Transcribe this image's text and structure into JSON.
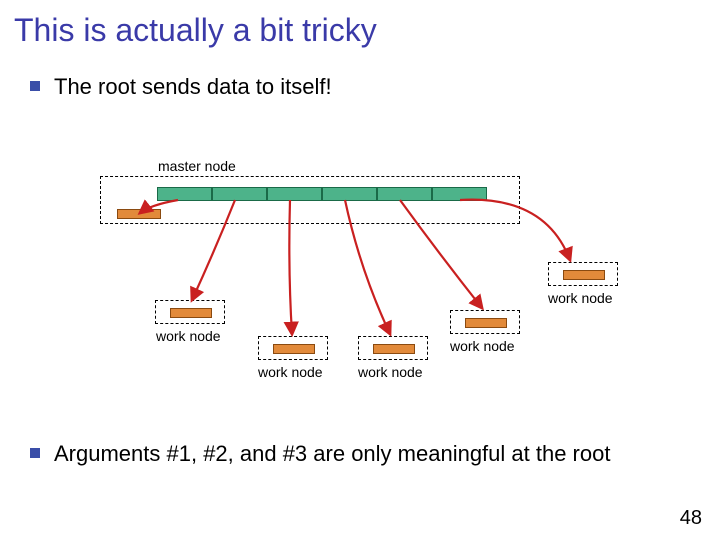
{
  "title": "This is actually a bit tricky",
  "bullets": [
    "The root sends data to itself!",
    "Arguments #1, #2, and #3 are only meaningful at the root"
  ],
  "diagram": {
    "master": {
      "label": "master node",
      "segments": 6
    },
    "workers": [
      {
        "label": "work node"
      },
      {
        "label": "work node"
      },
      {
        "label": "work node"
      },
      {
        "label": "work node"
      },
      {
        "label": "work node"
      }
    ]
  },
  "page_number": "48"
}
